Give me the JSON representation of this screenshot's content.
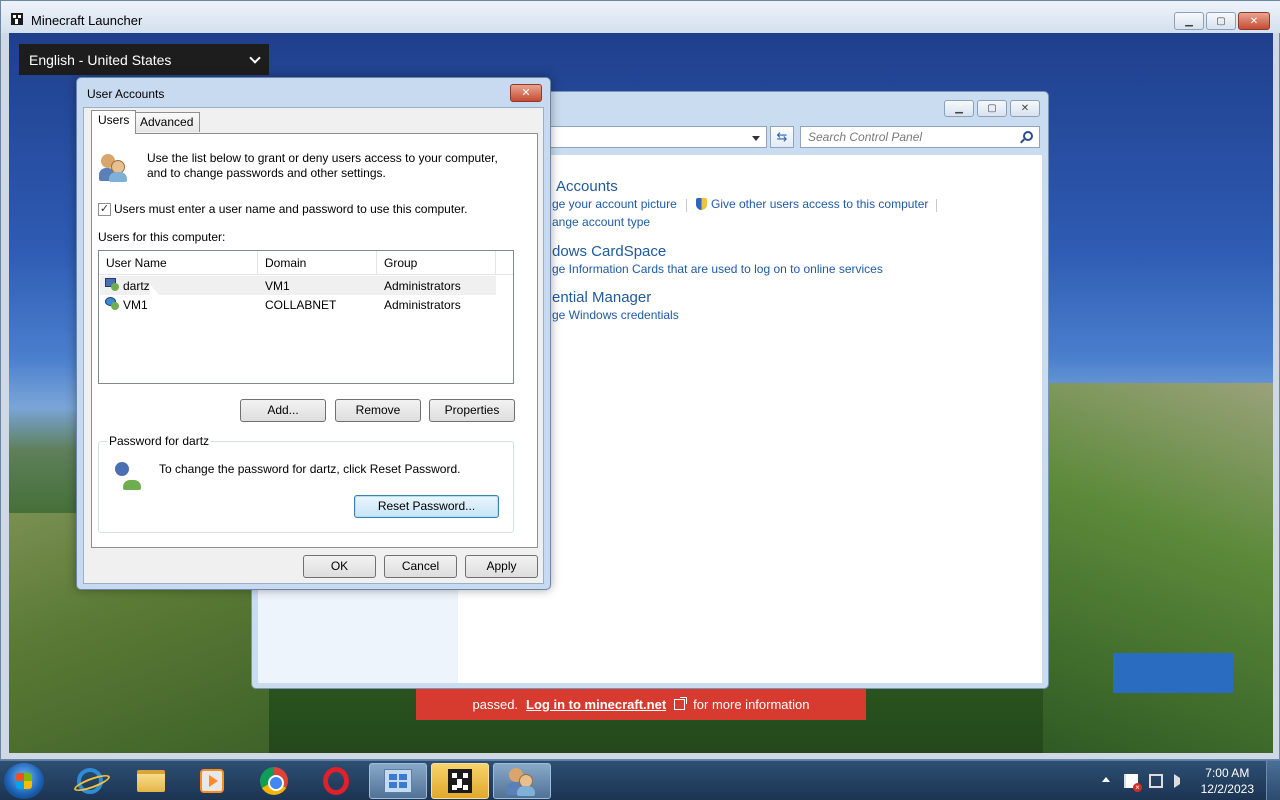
{
  "launcher": {
    "title": "Minecraft Launcher",
    "language_selected": "English - United States",
    "banner": {
      "prefix": "passed.",
      "link": "Log in to minecraft.net",
      "suffix": "for more information"
    }
  },
  "control_panel": {
    "search_placeholder": "Search Control Panel",
    "sections": [
      {
        "heading": "Accounts",
        "links": [
          "ge your account picture",
          "Give other users access to this computer",
          "ange account type"
        ]
      },
      {
        "heading": "dows CardSpace",
        "links": [
          "ge Information Cards that are used to log on to online services"
        ]
      },
      {
        "heading": "ential Manager",
        "links": [
          "ge Windows credentials"
        ]
      }
    ]
  },
  "dialog": {
    "title": "User Accounts",
    "tabs": [
      "Users",
      "Advanced"
    ],
    "intro_line1": "Use the list below to grant or deny users access to your computer,",
    "intro_line2": "and to change passwords and other settings.",
    "must_login_label": "Users must enter a user name and password to use this computer.",
    "must_login_checked": true,
    "users_label": "Users for this computer:",
    "columns": [
      "User Name",
      "Domain",
      "Group"
    ],
    "users": [
      {
        "name": "dartz",
        "domain": "VM1",
        "group": "Administrators"
      },
      {
        "name": "VM1",
        "domain": "COLLABNET",
        "group": "Administrators"
      }
    ],
    "buttons": {
      "add": "Add...",
      "remove": "Remove",
      "properties": "Properties",
      "reset": "Reset Password...",
      "ok": "OK",
      "cancel": "Cancel",
      "apply": "Apply"
    },
    "password_group_title": "Password for dartz",
    "password_text": "To change the password for dartz, click Reset Password."
  },
  "taskbar": {
    "time": "7:00 AM",
    "date": "12/2/2023"
  }
}
